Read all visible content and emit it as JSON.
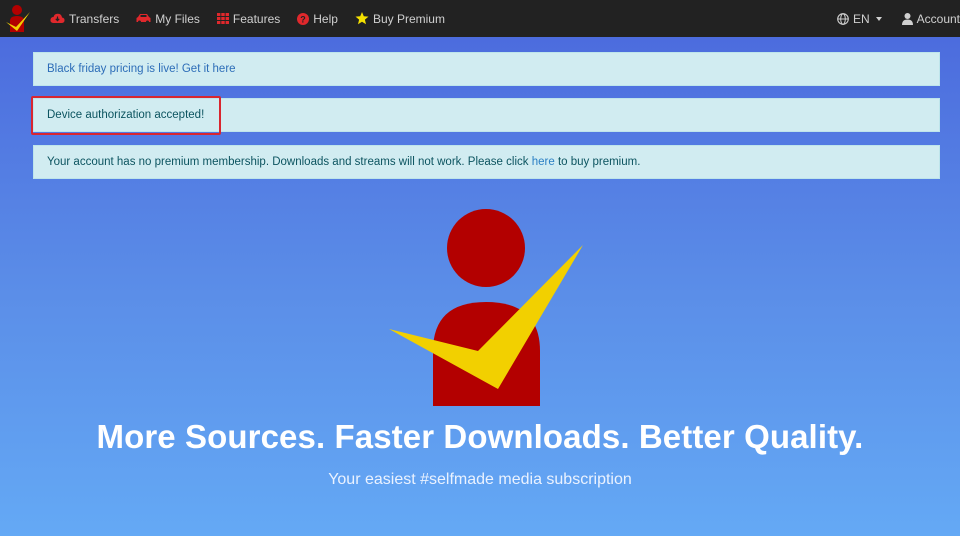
{
  "navbar": {
    "items": [
      {
        "label": "Transfers",
        "icon": "cloud-download-icon"
      },
      {
        "label": "My Files",
        "icon": "car-icon"
      },
      {
        "label": "Features",
        "icon": "grid-icon"
      },
      {
        "label": "Help",
        "icon": "question-circle-icon"
      },
      {
        "label": "Buy Premium",
        "icon": "star-icon"
      }
    ],
    "language": "EN",
    "account": "Account"
  },
  "alerts": {
    "promo_text": "Black friday pricing is live! Get it here",
    "auth_text": "Device authorization accepted!",
    "premium_before": "Your account has no premium membership. Downloads and streams will not work. Please click ",
    "premium_link": "here",
    "premium_after": " to buy premium."
  },
  "hero": {
    "headline": "More Sources. Faster Downloads. Better Quality.",
    "tagline": "Your easiest #selfmade media subscription"
  },
  "colors": {
    "brand_red": "#b30000",
    "brand_yellow": "#f2d000",
    "navbar_bg": "#222222",
    "alert_bg": "#d1ecf1",
    "highlight_border": "#d9262f"
  }
}
